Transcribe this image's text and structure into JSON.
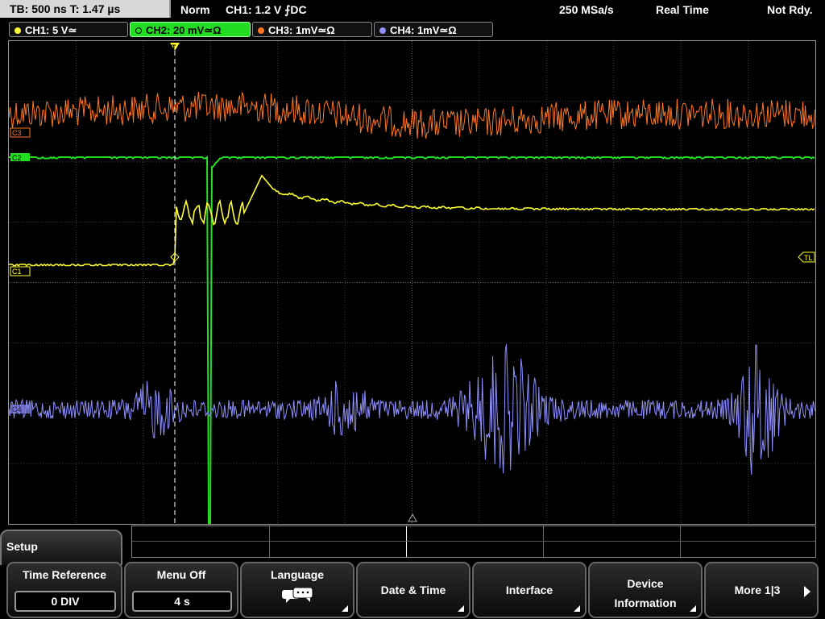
{
  "status": {
    "timebase": "TB: 500 ns  T: 1.47 µs",
    "trigger_mode": "Norm",
    "trigger_source": "CH1: 1.2 V ⨍DC",
    "sample_rate": "250 MSa/s",
    "acq_mode": "Real Time",
    "state": "Not Rdy."
  },
  "channels": [
    {
      "label": "CH1: 5 V≃",
      "color": "#ffff33",
      "active": false
    },
    {
      "label": "CH2: 20 mV≃Ω",
      "color": "#22dd22",
      "active": true
    },
    {
      "label": "CH3: 1mV≃Ω",
      "color": "#ff7722",
      "active": false
    },
    {
      "label": "CH4: 1mV≃Ω",
      "color": "#8f8fff",
      "active": false
    }
  ],
  "markers": {
    "c3": "C3",
    "c2": "C2",
    "c1": "C1",
    "c4": "C4",
    "trigger_level": "TL",
    "trigger_marker": "T"
  },
  "menu": {
    "title": "Setup",
    "softkeys": [
      {
        "label": "Time Reference",
        "value": "0 DIV"
      },
      {
        "label": "Menu Off",
        "value": "4 s"
      },
      {
        "label": "Language",
        "icon": "speech-bubble-icon"
      },
      {
        "label": "Date & Time"
      },
      {
        "label": "Interface"
      },
      {
        "label": "Device Information"
      },
      {
        "label": "More 1|3"
      }
    ]
  },
  "colors": {
    "ch1": "#ffff33",
    "ch2": "#22dd22",
    "ch3": "#ff7722",
    "ch4": "#8f8fff",
    "grid": "#555555"
  }
}
